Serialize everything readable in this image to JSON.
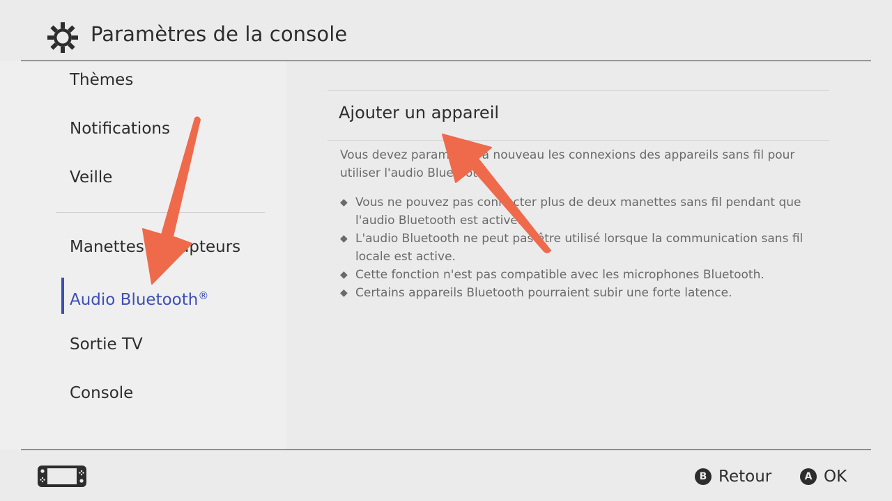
{
  "header": {
    "icon": "gear-icon",
    "title": "Paramètres de la console"
  },
  "sidebar": {
    "items": [
      {
        "label": "Thèmes",
        "active": false
      },
      {
        "label": "Notifications",
        "active": false
      },
      {
        "label": "Veille",
        "active": false
      },
      {
        "label": "Manettes et capteurs",
        "active": false
      },
      {
        "label": "Audio Bluetooth",
        "suffix": "®",
        "active": true
      },
      {
        "label": "Sortie TV",
        "active": false
      },
      {
        "label": "Console",
        "active": false
      }
    ],
    "active_color": "#3c4fb4"
  },
  "panel": {
    "title": "Ajouter un appareil",
    "description": "Vous devez paramétrer à nouveau les connexions des appareils sans fil pour utiliser l'audio Bluetooth.",
    "notes": [
      "Vous ne pouvez pas connecter plus de deux manettes sans fil pendant que l'audio Bluetooth est activé.",
      "L'audio Bluetooth ne peut pas être utilisé lorsque la communication sans fil locale est active.",
      "Cette fonction n'est pas compatible avec les microphones Bluetooth.",
      "Certains appareils Bluetooth pourraient subir une forte latence."
    ],
    "bullet": "◆"
  },
  "footer": {
    "console_icon": "handheld-console-icon",
    "buttons": [
      {
        "key": "B",
        "label": "Retour"
      },
      {
        "key": "A",
        "label": "OK"
      }
    ]
  },
  "annotations": {
    "arrow_color": "#ee6a4b",
    "arrows": [
      {
        "points_to": "sidebar-item-audio-bluetooth"
      },
      {
        "points_to": "add-device-option"
      }
    ]
  }
}
